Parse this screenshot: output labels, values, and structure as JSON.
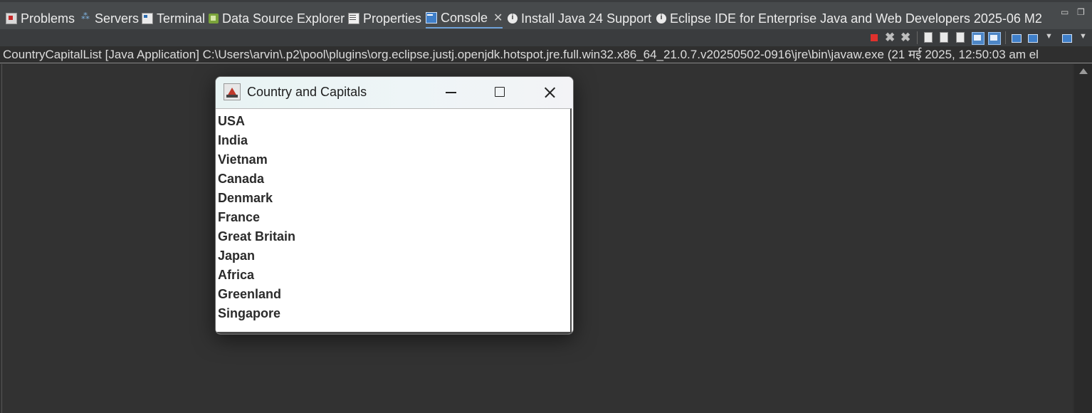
{
  "tabs": [
    {
      "label": "Problems",
      "icon": "problems-icon"
    },
    {
      "label": "Servers",
      "icon": "servers-icon"
    },
    {
      "label": "Terminal",
      "icon": "terminal-icon"
    },
    {
      "label": "Data Source Explorer",
      "icon": "data-source-explorer-icon"
    },
    {
      "label": "Properties",
      "icon": "properties-icon"
    },
    {
      "label": "Console",
      "icon": "console-icon",
      "active": true
    },
    {
      "label": "Install Java 24 Support",
      "icon": "info-icon"
    },
    {
      "label": "Eclipse IDE for Enterprise Java and Web Developers 2025-06 M2",
      "icon": "info-icon"
    }
  ],
  "console": {
    "header": "CountryCapitalList [Java Application] C:\\Users\\arvin\\.p2\\pool\\plugins\\org.eclipse.justj.openjdk.hotspot.jre.full.win32.x86_64_21.0.7.v20250502-0916\\jre\\bin\\javaw.exe  (21 मई 2025, 12:50:03 am el"
  },
  "app_window": {
    "title": "Country and Capitals",
    "countries": [
      "USA",
      "India",
      "Vietnam",
      "Canada",
      "Denmark",
      "France",
      "Great Britain",
      "Japan",
      "Africa",
      "Greenland",
      "Singapore"
    ]
  },
  "colors": {
    "ide_background": "#2f2f2f",
    "active_tab_underline": "#6ea0d6",
    "terminate_red": "#e0312d"
  }
}
